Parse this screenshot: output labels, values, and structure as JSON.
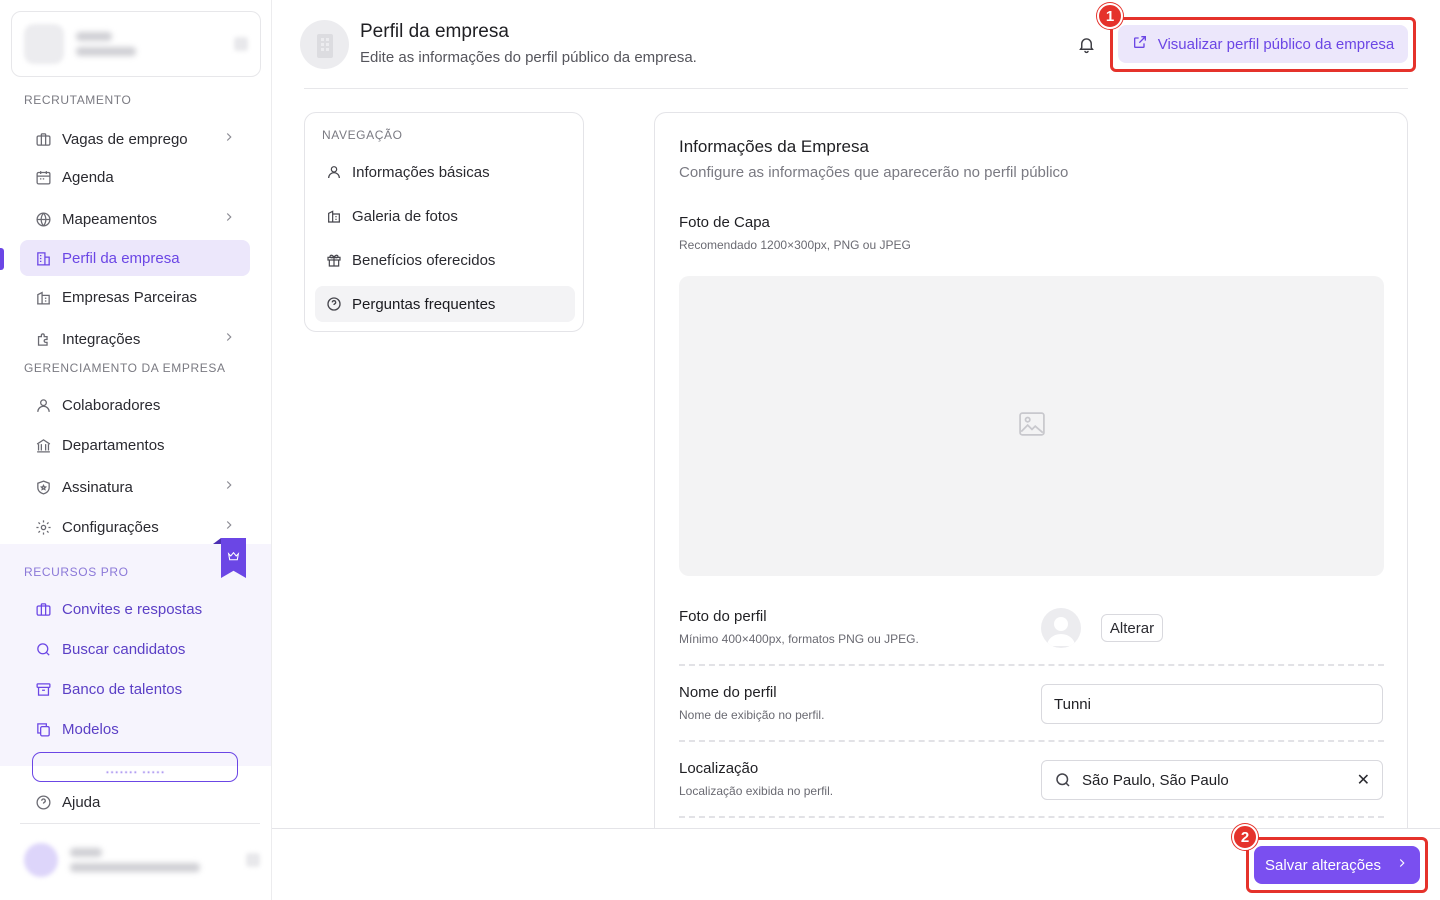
{
  "sidebar": {
    "sections": {
      "recruitment": "RECRUTAMENTO",
      "management": "GERENCIAMENTO DA EMPRESA",
      "pro": "RECURSOS PRO"
    },
    "recruitment_items": [
      {
        "label": "Vagas de emprego"
      },
      {
        "label": "Agenda"
      },
      {
        "label": "Mapeamentos"
      },
      {
        "label": "Perfil da empresa"
      },
      {
        "label": "Empresas Parceiras"
      },
      {
        "label": "Integrações"
      }
    ],
    "management_items": [
      {
        "label": "Colaboradores"
      },
      {
        "label": "Departamentos"
      },
      {
        "label": "Assinatura"
      },
      {
        "label": "Configurações"
      }
    ],
    "pro_items": [
      {
        "label": "Convites e respostas"
      },
      {
        "label": "Buscar candidatos"
      },
      {
        "label": "Banco de talentos"
      },
      {
        "label": "Modelos"
      }
    ],
    "help_label": "Ajuda",
    "active_item": "Perfil da empresa"
  },
  "header": {
    "title": "Perfil da empresa",
    "subtitle": "Edite as informações do perfil público da empresa.",
    "view_public_label": "Visualizar perfil público da empresa"
  },
  "annotations": [
    "1",
    "2"
  ],
  "navigation": {
    "label": "NAVEGAÇÃO",
    "items": [
      {
        "label": "Informações básicas"
      },
      {
        "label": "Galeria de fotos"
      },
      {
        "label": "Benefícios oferecidos"
      },
      {
        "label": "Perguntas frequentes"
      }
    ],
    "active_item": "Perguntas frequentes"
  },
  "main": {
    "title": "Informações da Empresa",
    "subtitle": "Configure as informações que aparecerão no perfil público",
    "cover": {
      "title": "Foto de Capa",
      "hint": "Recomendado 1200×300px, PNG ou JPEG"
    },
    "profile_photo": {
      "title": "Foto do perfil",
      "hint": "Mínimo 400×400px, formatos PNG ou JPEG.",
      "button": "Alterar"
    },
    "profile_name": {
      "title": "Nome do perfil",
      "hint": "Nome de exibição no perfil.",
      "value": "Tunni"
    },
    "location": {
      "title": "Localização",
      "hint": "Localização exibida no perfil.",
      "value": "São Paulo, São Paulo"
    }
  },
  "footer": {
    "save_label": "Salvar alterações"
  },
  "colors": {
    "accent": "#6b46e5",
    "accent_soft": "#ece7fb",
    "callout": "#e5322b"
  }
}
